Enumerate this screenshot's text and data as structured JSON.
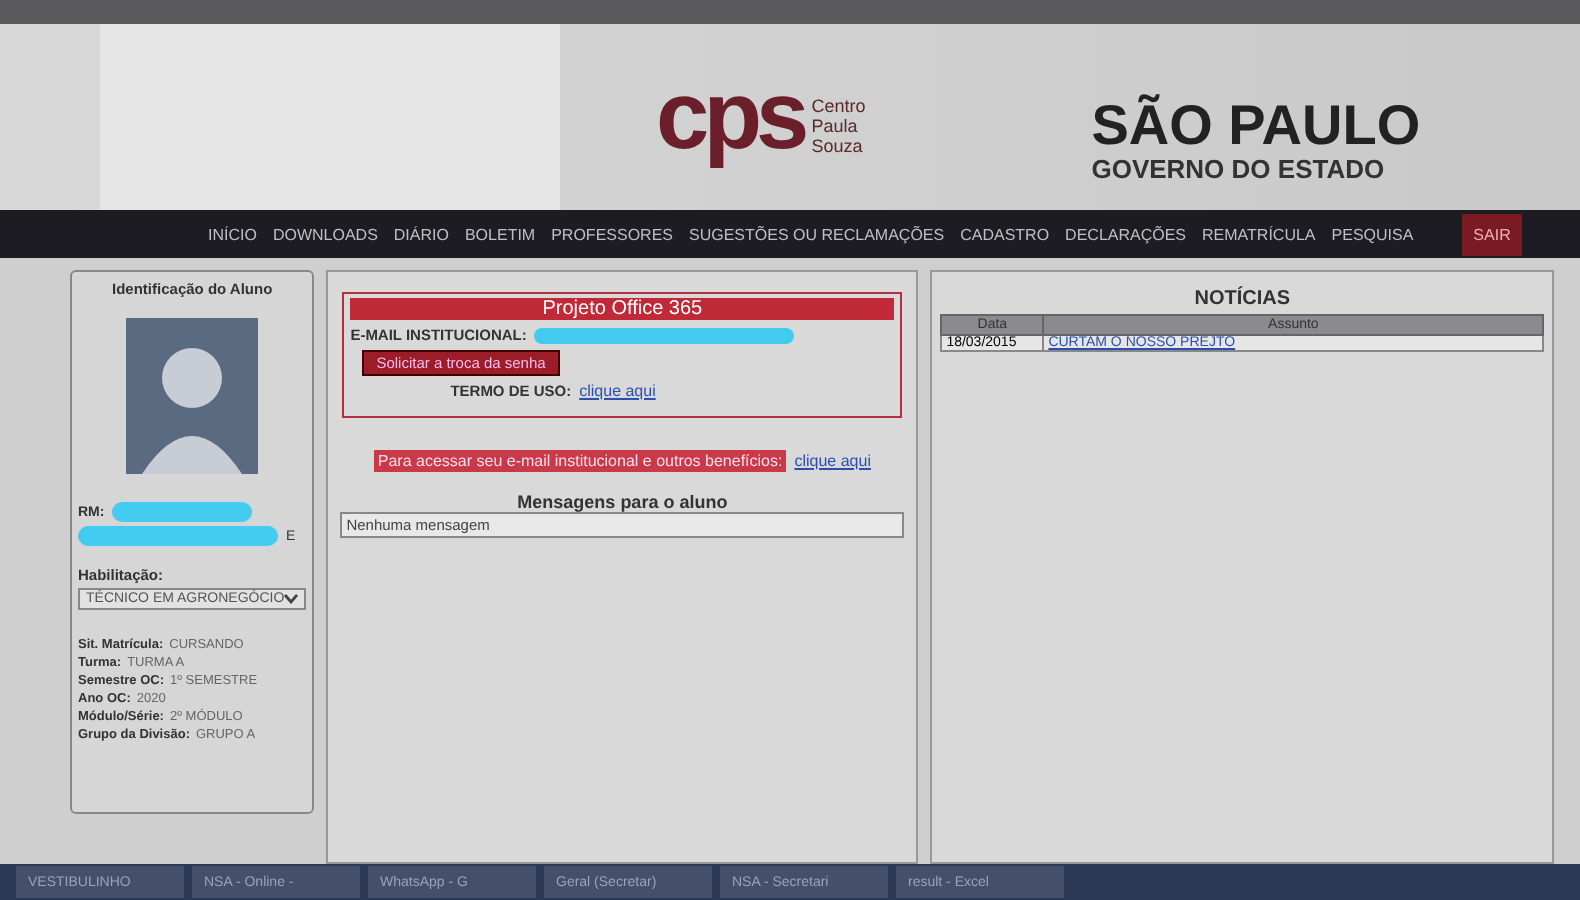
{
  "logos": {
    "cps_mark": "cps",
    "cps_name": "Centro Paula Souza",
    "sp_name": "SÃO PAULO",
    "sp_sub": "GOVERNO DO ESTADO"
  },
  "nav": [
    {
      "label": "INÍCIO",
      "kind": "link"
    },
    {
      "label": "DOWNLOADS",
      "kind": "link"
    },
    {
      "label": "DIÁRIO",
      "kind": "link"
    },
    {
      "label": "BOLETIM",
      "kind": "link"
    },
    {
      "label": "PROFESSORES",
      "kind": "link"
    },
    {
      "label": "SUGESTÕES OU RECLAMAÇÕES",
      "kind": "link"
    },
    {
      "label": "CADASTRO",
      "kind": "link"
    },
    {
      "label": "DECLARAÇÕES",
      "kind": "link"
    },
    {
      "label": "REMATRÍCULA",
      "kind": "link"
    },
    {
      "label": "PESQUISA",
      "kind": "link"
    },
    {
      "label": "SAIR",
      "kind": "exit"
    }
  ],
  "student": {
    "title": "Identificação do Aluno",
    "rm_label": "RM:",
    "letter": "E",
    "habilitacao_label": "Habilitação:",
    "habilitacao": "TÉCNICO EM AGRONEGÓCIO",
    "facts": [
      {
        "label": "Sit. Matrícula:",
        "value": "CURSANDO"
      },
      {
        "label": "Turma:",
        "value": "TURMA A"
      },
      {
        "label": "Semestre OC:",
        "value": "1º SEMESTRE"
      },
      {
        "label": "Ano OC:",
        "value": "2020"
      },
      {
        "label": "Módulo/Série:",
        "value": "2º MÓDULO"
      },
      {
        "label": "Grupo da Divisão:",
        "value": "GRUPO A"
      }
    ]
  },
  "office": {
    "title": "Projeto Office 365",
    "email_label": "E-MAIL INSTITUCIONAL:",
    "button": "Solicitar a troca da senha",
    "terms_label": "TERMO DE USO:",
    "terms_link": "clique aqui"
  },
  "access": {
    "text": "Para acessar seu e-mail institucional e outros benefícios:",
    "link": "clique aqui"
  },
  "messages": {
    "title": "Mensagens para o aluno",
    "items": [
      "Nenhuma mensagem"
    ]
  },
  "news": {
    "title": "NOTÍCIAS",
    "columns": [
      "Data",
      "Assunto"
    ],
    "rows": [
      {
        "date": "18/03/2015",
        "subject": "CURTAM O NOSSO PREJTO"
      }
    ]
  },
  "taskbar": [
    "VESTIBULINHO",
    "NSA - Online -",
    "WhatsApp - G",
    "Geral (Secretar)",
    "NSA - Secretari",
    "result - Excel"
  ]
}
